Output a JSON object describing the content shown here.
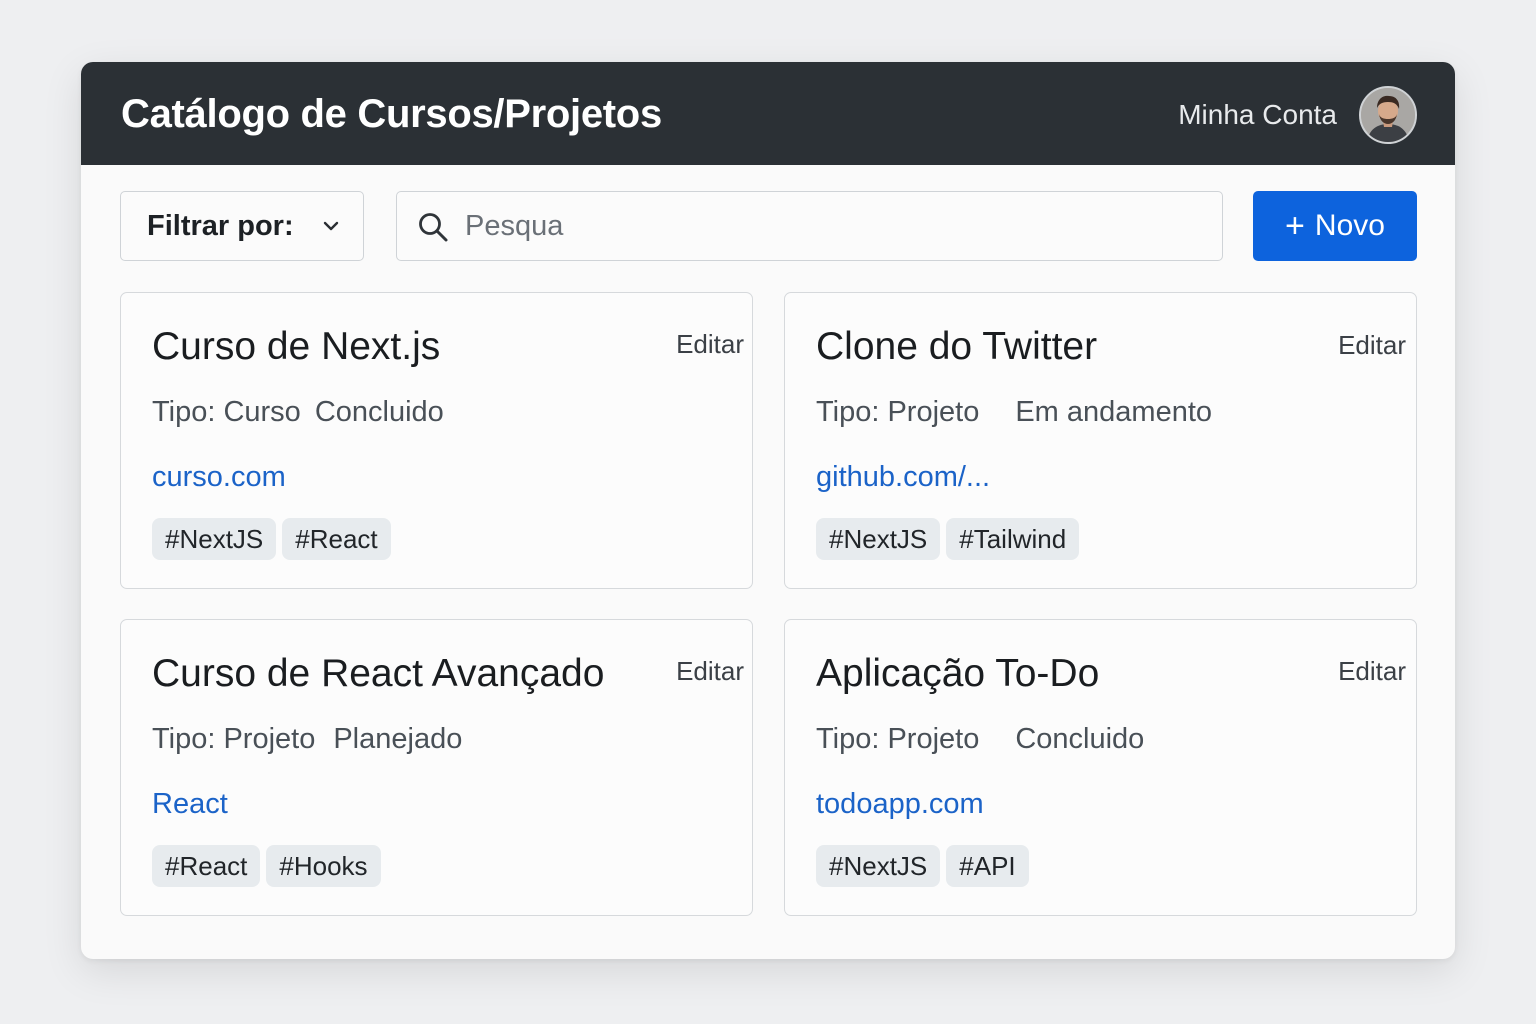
{
  "header": {
    "title": "Catálogo de Cursos/Projetos",
    "account_label": "Minha Conta"
  },
  "toolbar": {
    "filter_label": "Filtrar por:",
    "search_placeholder": "Pesqua",
    "new_button_plus": "+",
    "new_button_label": "Novo"
  },
  "colors": {
    "header_bg": "#2b3035",
    "primary": "#0d63dd",
    "link": "#1b63c8",
    "tag_bg": "#e7ebee"
  },
  "icons": {
    "filter": "chevron-down-icon",
    "search": "search-icon",
    "new": "plus-icon",
    "avatar": "user-avatar"
  },
  "cards": [
    {
      "title": "Curso de Next.js",
      "edit_label": "Editar",
      "type": "Tipo: Curso",
      "status": "Concluido",
      "link": "curso.com",
      "tags": [
        "#NextJS",
        "#React"
      ]
    },
    {
      "title": "Clone do Twitter",
      "edit_label": "Editar",
      "type": "Tipo: Projeto",
      "status": "Em andamento",
      "link": "github.com/...",
      "tags": [
        "#NextJS",
        "#Tailwind"
      ]
    },
    {
      "title": "Curso de React Avançado",
      "edit_label": "Editar",
      "type": "Tipo: Projeto",
      "status": "Planejado",
      "link": "React",
      "tags": [
        "#React",
        "#Hooks"
      ]
    },
    {
      "title": "Aplicação To-Do",
      "edit_label": "Editar",
      "type": "Tipo: Projeto",
      "status": "Concluido",
      "link": "todoapp.com",
      "tags": [
        "#NextJS",
        "#API"
      ]
    }
  ]
}
